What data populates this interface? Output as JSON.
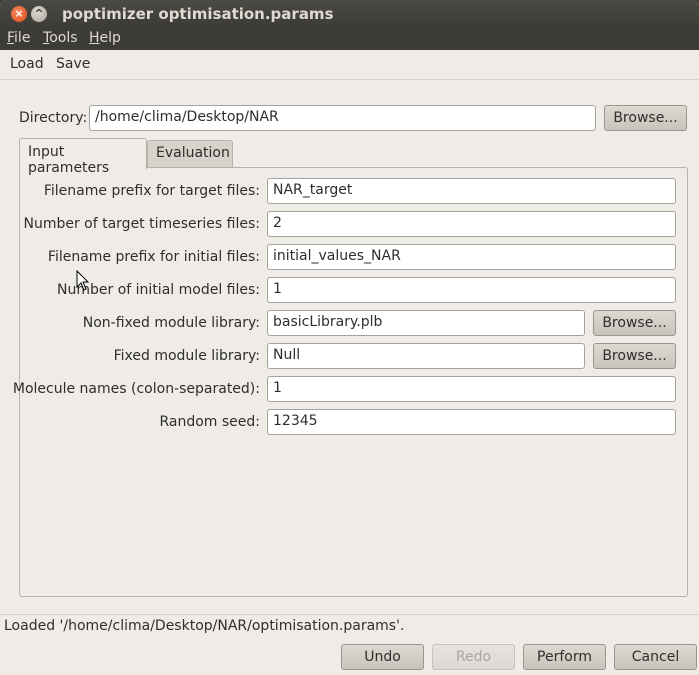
{
  "window": {
    "title": "poptimizer optimisation.params",
    "close_glyph": "×",
    "max_glyph": "^"
  },
  "menu": [
    "File",
    "Tools",
    "Help"
  ],
  "toolbar": {
    "load": "Load",
    "save": "Save"
  },
  "directory": {
    "label": "Directory:",
    "value": "/home/clima/Desktop/NAR",
    "browse": "Browse..."
  },
  "tabs": [
    {
      "label": "Input parameters",
      "active": true
    },
    {
      "label": "Evaluation",
      "active": false
    }
  ],
  "fields": [
    {
      "label": "Filename prefix for target files:",
      "value": "NAR_target"
    },
    {
      "label": "Number of target timeseries files:",
      "value": "2"
    },
    {
      "label": "Filename prefix for initial files:",
      "value": "initial_values_NAR"
    },
    {
      "label": "Number of initial model files:",
      "value": "1"
    },
    {
      "label": "Non-fixed module library:",
      "value": "basicLibrary.plb",
      "browse": "Browse..."
    },
    {
      "label": "Fixed module library:",
      "value": "Null",
      "browse": "Browse..."
    },
    {
      "label": "Molecule names (colon-separated):",
      "value": "1"
    },
    {
      "label": "Random seed:",
      "value": "12345"
    }
  ],
  "status": "Loaded '/home/clima/Desktop/NAR/optimisation.params'.",
  "buttons": {
    "undo": "Undo",
    "redo": "Redo",
    "perform": "Perform",
    "cancel": "Cancel"
  }
}
